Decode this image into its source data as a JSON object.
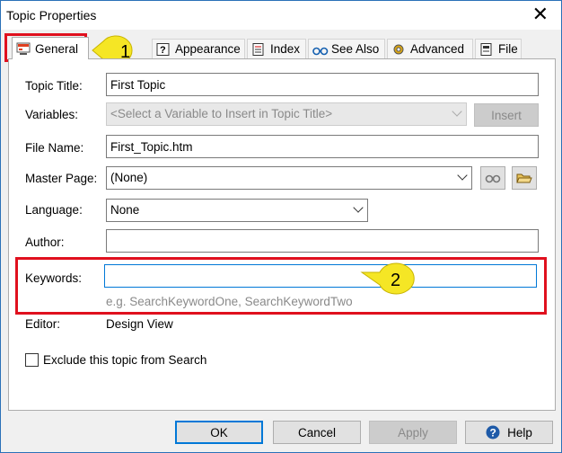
{
  "window": {
    "title": "Topic Properties",
    "close_glyph": "✕"
  },
  "tabs": [
    {
      "label": "General",
      "icon": "general-tab-icon"
    },
    {
      "label": "Appearance",
      "icon": "help-icon"
    },
    {
      "label": "Index",
      "icon": "index-icon"
    },
    {
      "label": "See Also",
      "icon": "glasses-icon"
    },
    {
      "label": "Advanced",
      "icon": "gear-icon"
    },
    {
      "label": "File",
      "icon": "file-icon"
    }
  ],
  "form": {
    "topic_title_label": "Topic Title:",
    "topic_title_value": "First Topic",
    "variables_label": "Variables:",
    "variables_placeholder": "<Select a Variable to Insert in Topic Title>",
    "insert_label": "Insert",
    "file_name_label": "File Name:",
    "file_name_value": "First_Topic.htm",
    "master_page_label": "Master Page:",
    "master_page_value": "(None)",
    "language_label": "Language:",
    "language_value": "None",
    "author_label": "Author:",
    "author_value": "",
    "keywords_label": "Keywords:",
    "keywords_value": "",
    "keywords_hint": "e.g. SearchKeywordOne, SearchKeywordTwo",
    "editor_label": "Editor:",
    "editor_value": "Design View",
    "exclude_label": "Exclude this topic from Search"
  },
  "annotations": {
    "callout_1": "1",
    "callout_2": "2",
    "highlight_color": "#e0101e",
    "callout_color": "#f5e625"
  },
  "footer": {
    "ok": "OK",
    "cancel": "Cancel",
    "apply": "Apply",
    "help": "Help"
  }
}
